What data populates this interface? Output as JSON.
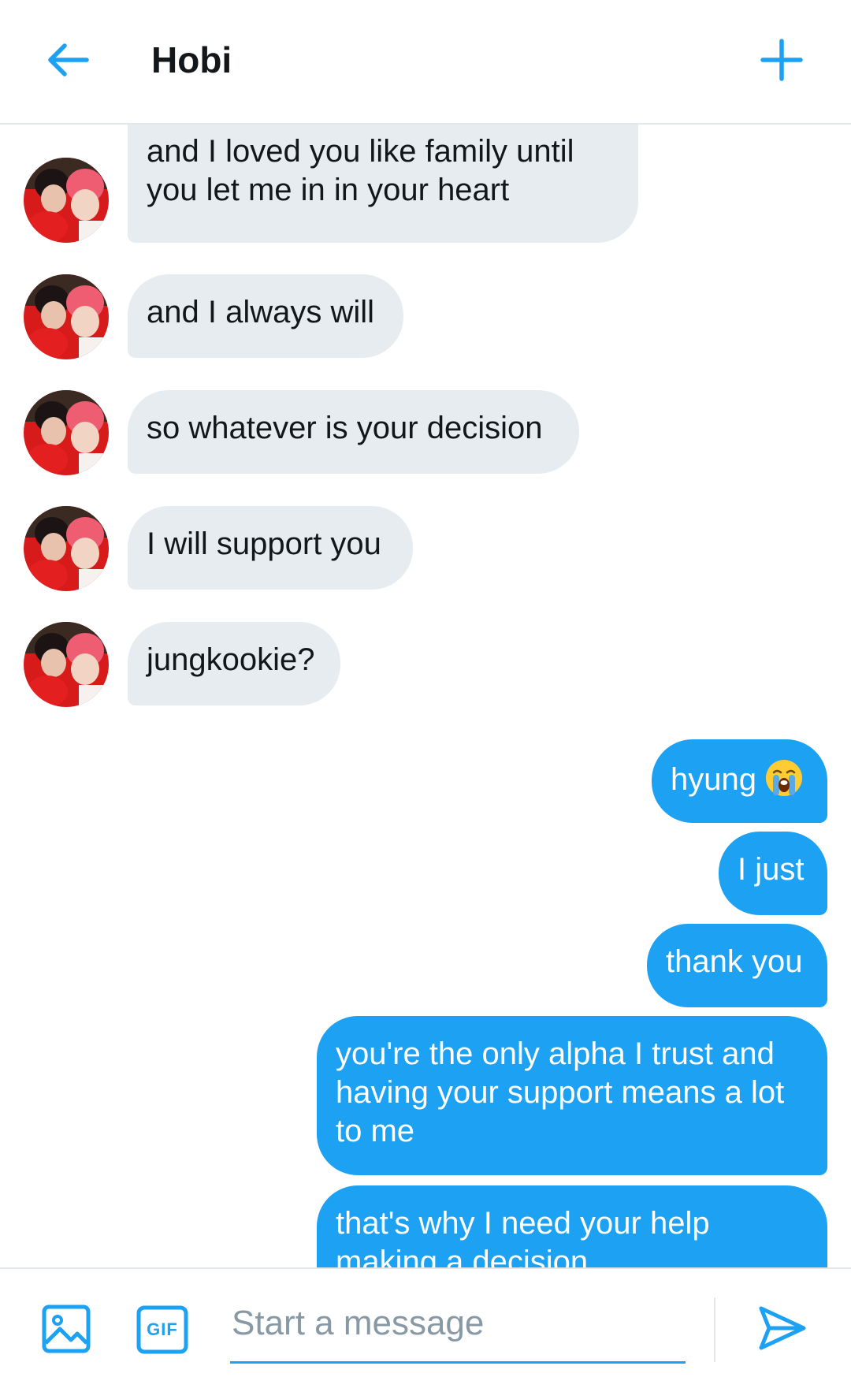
{
  "header": {
    "title": "Hobi"
  },
  "colors": {
    "accent": "#1da1f2",
    "incoming_bubble": "#e6ecf0",
    "text_dark": "#14171a",
    "placeholder": "#8899a6"
  },
  "messages": {
    "incoming": [
      {
        "text": "and I loved you like family until you let me in in your heart"
      },
      {
        "text": "and I always will"
      },
      {
        "text": "so whatever is your decision"
      },
      {
        "text": "I will support you"
      },
      {
        "text": "jungkookie?"
      }
    ],
    "outgoing": [
      {
        "text": "hyung",
        "emoji": "loudly-crying-face"
      },
      {
        "text": "I just"
      },
      {
        "text": "thank you"
      },
      {
        "text": "you're the only alpha I trust and having your support means a lot to me"
      },
      {
        "text": "that's why I need your help making a decision"
      }
    ]
  },
  "composer": {
    "placeholder": "Start a message",
    "gif_label": "GIF"
  },
  "icons": {
    "back": "arrow-left-icon",
    "add": "plus-icon",
    "media": "image-icon",
    "gif": "gif-icon",
    "send": "send-icon"
  }
}
